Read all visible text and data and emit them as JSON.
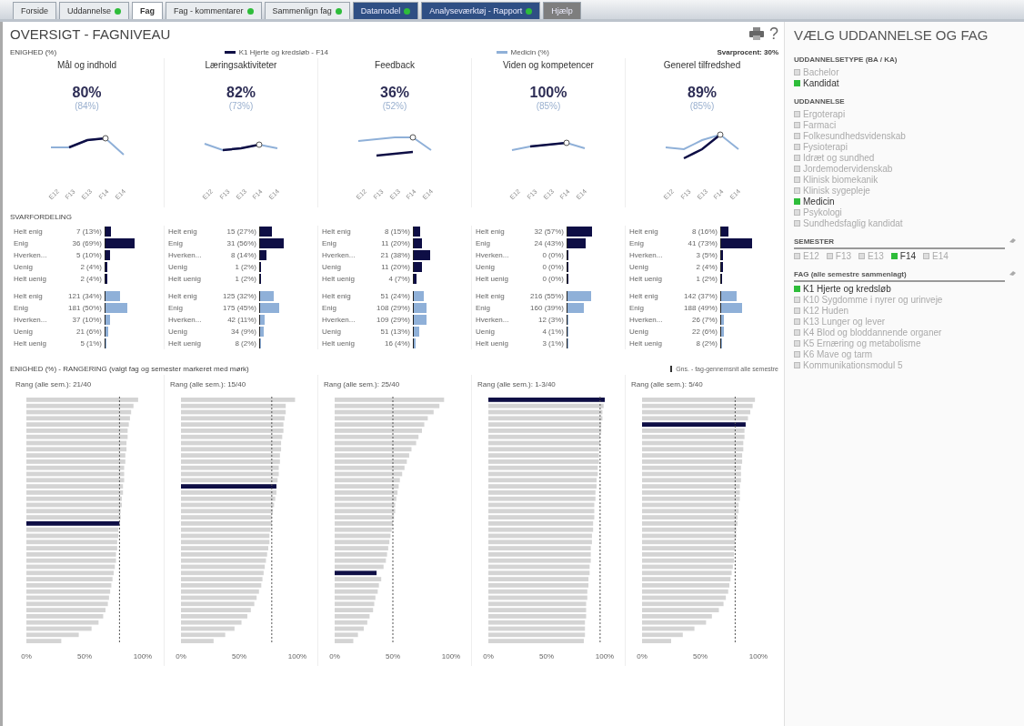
{
  "tabs": [
    {
      "label": "Forside",
      "selected": false,
      "dot": false,
      "kind": "plain"
    },
    {
      "label": "Uddannelse",
      "selected": false,
      "dot": true,
      "kind": "plain"
    },
    {
      "label": "Fag",
      "selected": true,
      "dot": false,
      "kind": "plain"
    },
    {
      "label": "Fag - kommentarer",
      "selected": false,
      "dot": true,
      "kind": "plain"
    },
    {
      "label": "Sammenlign fag",
      "selected": false,
      "dot": true,
      "kind": "plain"
    },
    {
      "label": "Datamodel",
      "selected": false,
      "dot": true,
      "kind": "report"
    },
    {
      "label": "Analyseværktøj - Rapport",
      "selected": false,
      "dot": true,
      "kind": "report"
    },
    {
      "label": "Hjælp",
      "selected": false,
      "dot": false,
      "kind": "help"
    }
  ],
  "header": {
    "title": "OVERSIGT - FAGNIVEAU",
    "help": "?"
  },
  "agreement": {
    "label": "ENIGHED (%)",
    "legend": [
      {
        "label": "K1 Hjerte og kredsløb - F14",
        "kind": "selected"
      },
      {
        "label": "Medicin (%)",
        "kind": "all"
      }
    ],
    "response_rate": "Svarprocent: 30%",
    "columns": [
      {
        "title": "Mål og indhold",
        "value": "80%",
        "comparison": "(84%)",
        "x_labels": [
          "E12",
          "F13",
          "E13",
          "F14",
          "E14"
        ]
      },
      {
        "title": "Læringsaktiviteter",
        "value": "82%",
        "comparison": "(73%)",
        "x_labels": [
          "E12",
          "F13",
          "E13",
          "F14",
          "E14"
        ]
      },
      {
        "title": "Feedback",
        "value": "36%",
        "comparison": "(52%)",
        "x_labels": [
          "E12",
          "F13",
          "E13",
          "F14",
          "E14"
        ]
      },
      {
        "title": "Viden og kompetencer",
        "value": "100%",
        "comparison": "(85%)",
        "x_labels": [
          "E12",
          "F13",
          "E13",
          "F14",
          "E14"
        ]
      },
      {
        "title": "Generel tilfredshed",
        "value": "89%",
        "comparison": "(85%)",
        "x_labels": [
          "E12",
          "F13",
          "E13",
          "F14",
          "E14"
        ]
      }
    ]
  },
  "distribution": {
    "label": "SVARFORDELING",
    "columns": [
      {
        "groups": [
          {
            "kind": "selected",
            "rows": [
              {
                "label": "Helt enig",
                "count": "7 (13%)",
                "level": 0.13
              },
              {
                "label": "Enig",
                "count": "36 (69%)",
                "level": 0.69
              },
              {
                "label": "Hverken...",
                "count": "5 (10%)",
                "level": 0.1
              },
              {
                "label": "Uenig",
                "count": "2 (4%)",
                "level": 0.04
              },
              {
                "label": "Helt uenig",
                "count": "2 (4%)",
                "level": 0.04
              }
            ]
          },
          {
            "kind": "all",
            "rows": [
              {
                "label": "Helt enig",
                "count": "121 (34%)",
                "level": 0.34
              },
              {
                "label": "Enig",
                "count": "181 (50%)",
                "level": 0.5
              },
              {
                "label": "Hverken...",
                "count": "37 (10%)",
                "level": 0.1
              },
              {
                "label": "Uenig",
                "count": "21 (6%)",
                "level": 0.06
              },
              {
                "label": "Helt uenig",
                "count": "5 (1%)",
                "level": 0.01
              }
            ]
          }
        ]
      },
      {
        "groups": [
          {
            "kind": "selected",
            "rows": [
              {
                "label": "Helt enig",
                "count": "15 (27%)",
                "level": 0.27
              },
              {
                "label": "Enig",
                "count": "31 (56%)",
                "level": 0.56
              },
              {
                "label": "Hverken...",
                "count": "8 (14%)",
                "level": 0.14
              },
              {
                "label": "Uenig",
                "count": "1 (2%)",
                "level": 0.02
              },
              {
                "label": "Helt uenig",
                "count": "1 (2%)",
                "level": 0.02
              }
            ]
          },
          {
            "kind": "all",
            "rows": [
              {
                "label": "Helt enig",
                "count": "125 (32%)",
                "level": 0.32
              },
              {
                "label": "Enig",
                "count": "175 (45%)",
                "level": 0.45
              },
              {
                "label": "Hverken...",
                "count": "42 (11%)",
                "level": 0.11
              },
              {
                "label": "Uenig",
                "count": "34 (9%)",
                "level": 0.09
              },
              {
                "label": "Helt uenig",
                "count": "8 (2%)",
                "level": 0.02
              }
            ]
          }
        ]
      },
      {
        "groups": [
          {
            "kind": "selected",
            "rows": [
              {
                "label": "Helt enig",
                "count": "8 (15%)",
                "level": 0.15
              },
              {
                "label": "Enig",
                "count": "11 (20%)",
                "level": 0.2
              },
              {
                "label": "Hverken...",
                "count": "21 (38%)",
                "level": 0.38
              },
              {
                "label": "Uenig",
                "count": "11 (20%)",
                "level": 0.2
              },
              {
                "label": "Helt uenig",
                "count": "4 (7%)",
                "level": 0.07
              }
            ]
          },
          {
            "kind": "all",
            "rows": [
              {
                "label": "Helt enig",
                "count": "51 (24%)",
                "level": 0.24
              },
              {
                "label": "Enig",
                "count": "108 (29%)",
                "level": 0.29
              },
              {
                "label": "Hverken...",
                "count": "109 (29%)",
                "level": 0.29
              },
              {
                "label": "Uenig",
                "count": "51 (13%)",
                "level": 0.13
              },
              {
                "label": "Helt uenig",
                "count": "16 (4%)",
                "level": 0.04
              }
            ]
          }
        ]
      },
      {
        "groups": [
          {
            "kind": "selected",
            "rows": [
              {
                "label": "Helt enig",
                "count": "32 (57%)",
                "level": 0.57
              },
              {
                "label": "Enig",
                "count": "24 (43%)",
                "level": 0.43
              },
              {
                "label": "Hverken...",
                "count": "0 (0%)",
                "level": 0
              },
              {
                "label": "Uenig",
                "count": "0 (0%)",
                "level": 0
              },
              {
                "label": "Helt uenig",
                "count": "0 (0%)",
                "level": 0
              }
            ]
          },
          {
            "kind": "all",
            "rows": [
              {
                "label": "Helt enig",
                "count": "216 (55%)",
                "level": 0.55
              },
              {
                "label": "Enig",
                "count": "160 (39%)",
                "level": 0.39
              },
              {
                "label": "Hverken...",
                "count": "12 (3%)",
                "level": 0.03
              },
              {
                "label": "Uenig",
                "count": "4 (1%)",
                "level": 0.01
              },
              {
                "label": "Helt uenig",
                "count": "3 (1%)",
                "level": 0.01
              }
            ]
          }
        ]
      },
      {
        "groups": [
          {
            "kind": "selected",
            "rows": [
              {
                "label": "Helt enig",
                "count": "8 (16%)",
                "level": 0.16
              },
              {
                "label": "Enig",
                "count": "41 (73%)",
                "level": 0.73
              },
              {
                "label": "Hverken...",
                "count": "3 (5%)",
                "level": 0.05
              },
              {
                "label": "Uenig",
                "count": "2 (4%)",
                "level": 0.04
              },
              {
                "label": "Helt uenig",
                "count": "1 (2%)",
                "level": 0.02
              }
            ]
          },
          {
            "kind": "all",
            "rows": [
              {
                "label": "Helt enig",
                "count": "142 (37%)",
                "level": 0.37
              },
              {
                "label": "Enig",
                "count": "188 (49%)",
                "level": 0.49
              },
              {
                "label": "Hverken...",
                "count": "26 (7%)",
                "level": 0.07
              },
              {
                "label": "Uenig",
                "count": "22 (6%)",
                "level": 0.06
              },
              {
                "label": "Helt uenig",
                "count": "8 (2%)",
                "level": 0.02
              }
            ]
          }
        ]
      }
    ]
  },
  "ranking": {
    "label": "ENIGHED (%) - RANGERING (valgt fag og semester markeret med mørk)",
    "legend": "Gns. - fag-gennemsnit alle semestre",
    "charts": [
      {
        "title": "Rang (alle sem.): 21/40",
        "chart_data": {
          "type": "bar",
          "orientation": "horizontal",
          "stacked": true,
          "xlim": [
            0,
            100
          ],
          "xticks": [
            {
              "value": 0,
              "label": "0%"
            },
            {
              "value": 50,
              "label": "50%"
            },
            {
              "value": 100,
              "label": "100%"
            }
          ],
          "ref_lines": [
            {
              "value": 80,
              "axis": "x"
            }
          ],
          "series": [
            {
              "color": "#d4d4d4",
              "values": [
                96,
                92,
                90,
                89,
                88,
                87,
                87,
                86,
                86,
                85,
                85,
                84,
                84,
                84,
                83,
                83,
                82,
                82,
                81,
                81,
                null,
                79,
                79,
                78,
                78,
                77,
                77,
                76,
                75,
                74,
                73,
                72,
                71,
                70,
                68,
                66,
                62,
                56,
                45,
                30
              ]
            },
            {
              "color": "#0e0e45",
              "values": [
                null,
                null,
                null,
                null,
                null,
                null,
                null,
                null,
                null,
                null,
                null,
                null,
                null,
                null,
                null,
                null,
                null,
                null,
                null,
                null,
                80,
                null,
                null,
                null,
                null,
                null,
                null,
                null,
                null,
                null,
                null,
                null,
                null,
                null,
                null,
                null,
                null,
                null,
                null,
                null
              ]
            }
          ]
        }
      },
      {
        "title": "Rang (alle sem.): 15/40",
        "chart_data": {
          "type": "bar",
          "orientation": "horizontal",
          "stacked": true,
          "xlim": [
            0,
            100
          ],
          "xticks": [
            {
              "value": 0,
              "label": "0%"
            },
            {
              "value": 50,
              "label": "50%"
            },
            {
              "value": 100,
              "label": "100%"
            }
          ],
          "ref_lines": [
            {
              "value": 78,
              "axis": "x"
            }
          ],
          "series": [
            {
              "color": "#d4d4d4",
              "values": [
                98,
                90,
                90,
                89,
                88,
                88,
                87,
                86,
                86,
                85,
                85,
                84,
                84,
                83,
                null,
                82,
                81,
                80,
                79,
                78,
                78,
                77,
                76,
                76,
                75,
                74,
                73,
                72,
                71,
                70,
                69,
                67,
                65,
                63,
                60,
                57,
                52,
                46,
                38,
                28
              ]
            },
            {
              "color": "#0e0e45",
              "values": [
                null,
                null,
                null,
                null,
                null,
                null,
                null,
                null,
                null,
                null,
                null,
                null,
                null,
                null,
                82,
                null,
                null,
                null,
                null,
                null,
                null,
                null,
                null,
                null,
                null,
                null,
                null,
                null,
                null,
                null,
                null,
                null,
                null,
                null,
                null,
                null,
                null,
                null,
                null,
                null
              ]
            }
          ]
        }
      },
      {
        "title": "Rang (alle sem.): 25/40",
        "chart_data": {
          "type": "bar",
          "orientation": "horizontal",
          "stacked": true,
          "xlim": [
            0,
            100
          ],
          "xticks": [
            {
              "value": 0,
              "label": "0%"
            },
            {
              "value": 50,
              "label": "50%"
            },
            {
              "value": 100,
              "label": "100%"
            }
          ],
          "ref_lines": [
            {
              "value": 50,
              "axis": "x"
            }
          ],
          "series": [
            {
              "color": "#d4d4d4",
              "values": [
                94,
                90,
                85,
                80,
                77,
                75,
                72,
                70,
                66,
                64,
                62,
                60,
                58,
                56,
                55,
                54,
                53,
                52,
                52,
                51,
                50,
                49,
                48,
                47,
                46,
                45,
                44,
                42,
                null,
                40,
                38,
                37,
                35,
                34,
                33,
                30,
                28,
                25,
                20,
                16
              ]
            },
            {
              "color": "#0e0e45",
              "values": [
                null,
                null,
                null,
                null,
                null,
                null,
                null,
                null,
                null,
                null,
                null,
                null,
                null,
                null,
                null,
                null,
                null,
                null,
                null,
                null,
                null,
                null,
                null,
                null,
                null,
                null,
                null,
                null,
                36,
                null,
                null,
                null,
                null,
                null,
                null,
                null,
                null,
                null,
                null,
                null
              ]
            }
          ]
        }
      },
      {
        "title": "Rang (alle sem.): 1-3/40",
        "chart_data": {
          "type": "bar",
          "orientation": "horizontal",
          "stacked": true,
          "xlim": [
            0,
            100
          ],
          "xticks": [
            {
              "value": 0,
              "label": "0%"
            },
            {
              "value": 50,
              "label": "50%"
            },
            {
              "value": 100,
              "label": "100%"
            }
          ],
          "ref_lines": [
            {
              "value": 96,
              "axis": "x"
            }
          ],
          "series": [
            {
              "color": "#d4d4d4",
              "values": [
                null,
                99,
                98,
                98,
                97,
                97,
                96,
                96,
                95,
                95,
                95,
                94,
                94,
                93,
                93,
                92,
                92,
                91,
                91,
                91,
                90,
                90,
                89,
                89,
                88,
                88,
                88,
                87,
                87,
                86,
                86,
                85,
                85,
                84,
                84,
                84,
                83,
                83,
                83,
                82
              ]
            },
            {
              "color": "#0e0e45",
              "values": [
                100,
                null,
                null,
                null,
                null,
                null,
                null,
                null,
                null,
                null,
                null,
                null,
                null,
                null,
                null,
                null,
                null,
                null,
                null,
                null,
                null,
                null,
                null,
                null,
                null,
                null,
                null,
                null,
                null,
                null,
                null,
                null,
                null,
                null,
                null,
                null,
                null,
                null,
                null,
                null
              ]
            }
          ]
        }
      },
      {
        "title": "Rang (alle sem.): 5/40",
        "chart_data": {
          "type": "bar",
          "orientation": "horizontal",
          "stacked": true,
          "xlim": [
            0,
            100
          ],
          "xticks": [
            {
              "value": 0,
              "label": "0%"
            },
            {
              "value": 50,
              "label": "50%"
            },
            {
              "value": 100,
              "label": "100%"
            }
          ],
          "ref_lines": [
            {
              "value": 80,
              "axis": "x"
            }
          ],
          "series": [
            {
              "color": "#d4d4d4",
              "values": [
                97,
                95,
                93,
                91,
                null,
                88,
                88,
                87,
                87,
                86,
                86,
                85,
                85,
                85,
                84,
                84,
                84,
                83,
                83,
                82,
                82,
                81,
                81,
                80,
                80,
                79,
                79,
                78,
                77,
                76,
                75,
                74,
                72,
                70,
                66,
                60,
                55,
                45,
                35,
                25
              ]
            },
            {
              "color": "#0e0e45",
              "values": [
                null,
                null,
                null,
                null,
                89,
                null,
                null,
                null,
                null,
                null,
                null,
                null,
                null,
                null,
                null,
                null,
                null,
                null,
                null,
                null,
                null,
                null,
                null,
                null,
                null,
                null,
                null,
                null,
                null,
                null,
                null,
                null,
                null,
                null,
                null,
                null,
                null,
                null,
                null,
                null
              ]
            }
          ]
        }
      }
    ]
  },
  "sidebar": {
    "title": "VÆLG UDDANNELSE OG FAG",
    "sections": [
      {
        "title": "UDDANNELSETYPE (BA / KA)",
        "kind": "list",
        "tool": false,
        "items": [
          {
            "label": "Bachelor",
            "selected": false
          },
          {
            "label": "Kandidat",
            "selected": true
          }
        ]
      },
      {
        "title": "UDDANNELSE",
        "kind": "list",
        "tool": false,
        "items": [
          {
            "label": "Ergoterapi",
            "selected": false
          },
          {
            "label": "Farmaci",
            "selected": false
          },
          {
            "label": "Folkesundhedsvidenskab",
            "selected": false
          },
          {
            "label": "Fysioterapi",
            "selected": false
          },
          {
            "label": "Idræt og sundhed",
            "selected": false
          },
          {
            "label": "Jordemodervidenskab",
            "selected": false
          },
          {
            "label": "Klinisk biomekanik",
            "selected": false
          },
          {
            "label": "Klinisk sygepleje",
            "selected": false
          },
          {
            "label": "Medicin",
            "selected": true
          },
          {
            "label": "Psykologi",
            "selected": false
          },
          {
            "label": "Sundhedsfaglig kandidat",
            "selected": false
          }
        ]
      },
      {
        "title": "SEMESTER",
        "kind": "inline",
        "tool": true,
        "items": [
          {
            "label": "E12",
            "selected": false
          },
          {
            "label": "F13",
            "selected": false
          },
          {
            "label": "E13",
            "selected": false
          },
          {
            "label": "F14",
            "selected": true
          },
          {
            "label": "E14",
            "selected": false
          }
        ]
      },
      {
        "title": "FAG (alle semestre sammenlagt)",
        "kind": "list",
        "tool": true,
        "items": [
          {
            "label": "K1 Hjerte og kredsløb",
            "selected": true
          },
          {
            "label": "K10 Sygdomme i nyrer og urinveje",
            "selected": false
          },
          {
            "label": "K12 Huden",
            "selected": false
          },
          {
            "label": "K13 Lunger og lever",
            "selected": false
          },
          {
            "label": "K4 Blod og bloddannende organer",
            "selected": false
          },
          {
            "label": "K5 Ernæring og metabolisme",
            "selected": false
          },
          {
            "label": "K6 Mave og tarm",
            "selected": false
          },
          {
            "label": "Kommunikationsmodul 5",
            "selected": false
          }
        ]
      }
    ]
  }
}
